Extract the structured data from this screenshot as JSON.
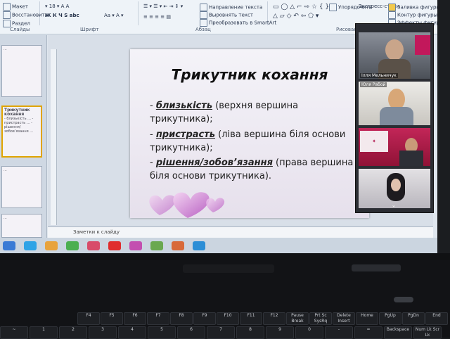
{
  "ribbon": {
    "row1": [
      "Макет",
      "Шрифт",
      "Выравнивание",
      "Направление текста",
      "Упорядочить",
      "Экспресс-стили",
      "Заливка фигуры"
    ],
    "row2": [
      "Восстановить",
      "Выровнять текст",
      "Контур фигуры"
    ],
    "row3": [
      "Раздел",
      "Преобразовать в SmartArt",
      "Эффекты фигур"
    ],
    "groups": [
      "Слайды",
      "Шрифт",
      "Абзац",
      "Рисование"
    ]
  },
  "slide": {
    "title": "Трикутник кохання",
    "bullets": [
      {
        "prefix": "- ",
        "keyword": "близькість",
        "rest": " (верхня вершина"
      },
      {
        "prefix": "",
        "keyword": "",
        "rest": "трикутника);"
      },
      {
        "prefix": "- ",
        "keyword": "пристрасть",
        "rest": " (ліва вершина біля основи"
      },
      {
        "prefix": "",
        "keyword": "",
        "rest": "трикутника);"
      },
      {
        "prefix": "- ",
        "keyword": "рішення/зобов’язання",
        "rest": " (права вершина"
      },
      {
        "prefix": "",
        "keyword": "",
        "rest": "біля основи трикутника)."
      }
    ]
  },
  "notes": {
    "placeholder": "Заметки к слайду"
  },
  "thumbnails": [
    {
      "num": "6",
      "title": "",
      "text": "..."
    },
    {
      "num": "7",
      "title": "Трикутник кохання",
      "text": "- близькість ... - пристрасть ... - рішення/зобов’язання ..."
    },
    {
      "num": "8",
      "title": "",
      "text": "..."
    },
    {
      "num": "9",
      "title": "",
      "text": "..."
    }
  ],
  "video": {
    "participants": [
      {
        "name": "Ілля Мельничук"
      },
      {
        "name": "Юля Рабой"
      },
      {
        "name": ""
      },
      {
        "name": ""
      }
    ]
  },
  "keyboard": {
    "fkeys": [
      "F4",
      "F5",
      "F6",
      "F7",
      "F8",
      "F9",
      "F10",
      "F11",
      "F12",
      "Pause Break",
      "Prt Sc SysRq",
      "Delete Insert",
      "Home",
      "PgUp",
      "PgDn",
      "End"
    ],
    "lower": [
      "~",
      "1",
      "2",
      "3",
      "4",
      "5",
      "6",
      "7",
      "8",
      "9",
      "0",
      "-",
      "=",
      "Backspace",
      "Num Lk Scr Lk"
    ]
  },
  "colors": {
    "accent": "#c2185b",
    "ribbon": "#eef3f8",
    "slide_bg": "#efedf4"
  }
}
